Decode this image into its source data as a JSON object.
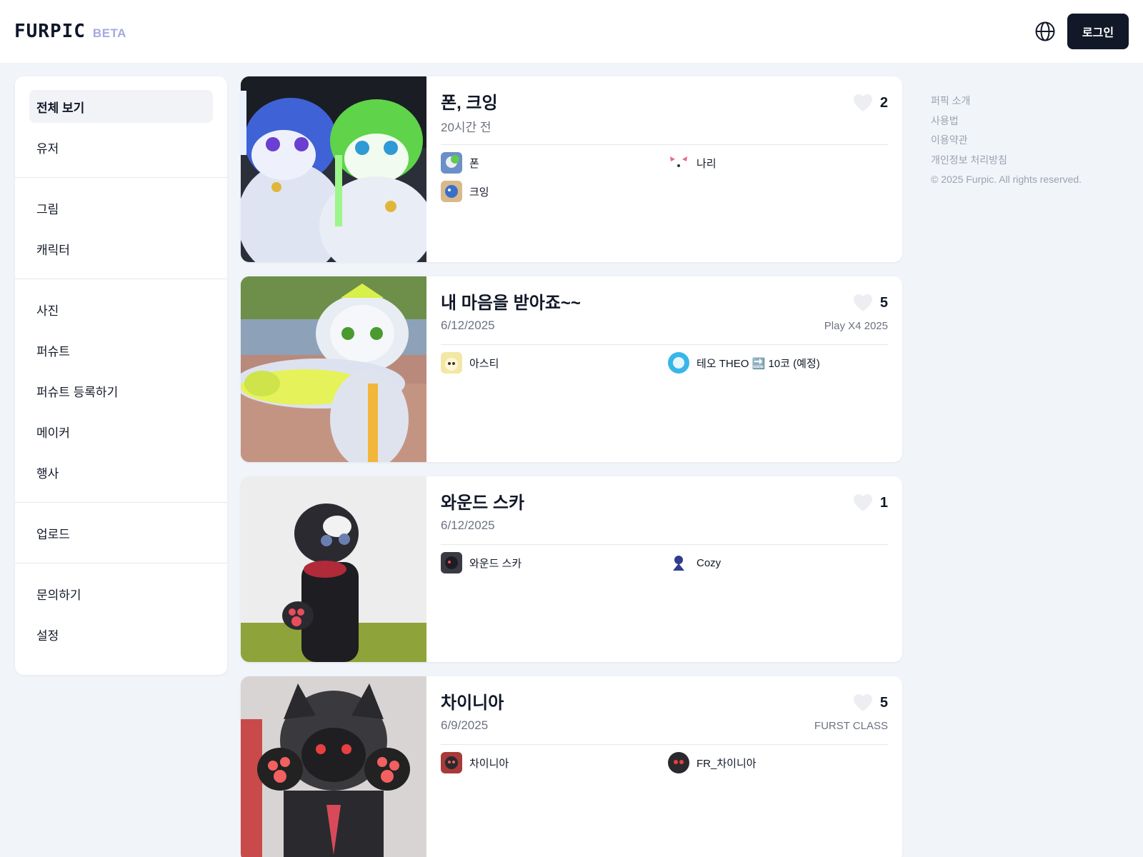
{
  "header": {
    "logo": "FURPIC",
    "beta": "BETA",
    "globe_icon": "globe-icon",
    "login_label": "로그인"
  },
  "sidebar": {
    "groups": [
      [
        {
          "label": "전체 보기",
          "active": true
        },
        {
          "label": "유저"
        }
      ],
      [
        {
          "label": "그림"
        },
        {
          "label": "캐릭터"
        }
      ],
      [
        {
          "label": "사진"
        },
        {
          "label": "퍼슈트"
        },
        {
          "label": "퍼슈트 등록하기"
        },
        {
          "label": "메이커"
        },
        {
          "label": "행사"
        }
      ],
      [
        {
          "label": "업로드"
        }
      ],
      [
        {
          "label": "문의하기"
        },
        {
          "label": "설정"
        }
      ]
    ]
  },
  "feed": {
    "cards": [
      {
        "title": "폰, 크잉",
        "date": "20시간 전",
        "event": "",
        "likes": "2",
        "tags": [
          {
            "name": "폰",
            "avatar_color": "#6b8fc7"
          },
          {
            "name": "나리",
            "avatar_color": "#f4c9cf"
          },
          {
            "name": "크잉",
            "avatar_color": "#6aa0d6"
          }
        ]
      },
      {
        "title": "내 마음을 받아죠~~",
        "date": "6/12/2025",
        "event": "Play X4 2025",
        "likes": "5",
        "tags": [
          {
            "name": "아스티",
            "avatar_color": "#f3e7a6"
          },
          {
            "name": "테오 THEO 🔜 10코 (예정)",
            "avatar_color": "#38b6e8"
          }
        ]
      },
      {
        "title": "와운드 스카",
        "date": "6/12/2025",
        "event": "",
        "likes": "1",
        "tags": [
          {
            "name": "와운드 스카",
            "avatar_color": "#3a3a44"
          },
          {
            "name": "Cozy",
            "avatar_color": "#2f3d8f"
          }
        ]
      },
      {
        "title": "차이니아",
        "date": "6/9/2025",
        "event": "FURST CLASS",
        "likes": "5",
        "tags": [
          {
            "name": "차이니아",
            "avatar_color": "#a83a3a"
          },
          {
            "name": "FR_차이니아",
            "avatar_color": "#2a2a2e"
          }
        ]
      }
    ]
  },
  "footer": {
    "links": [
      "퍼픽 소개",
      "사용법",
      "이용약관",
      "개인정보 처리방침"
    ],
    "copyright": "© 2025 Furpic. All rights reserved."
  },
  "colors": {
    "background": "#f1f4f9",
    "primary_button": "#111827",
    "beta_accent": "#a5a9e0",
    "muted_text": "#9ca3af"
  }
}
